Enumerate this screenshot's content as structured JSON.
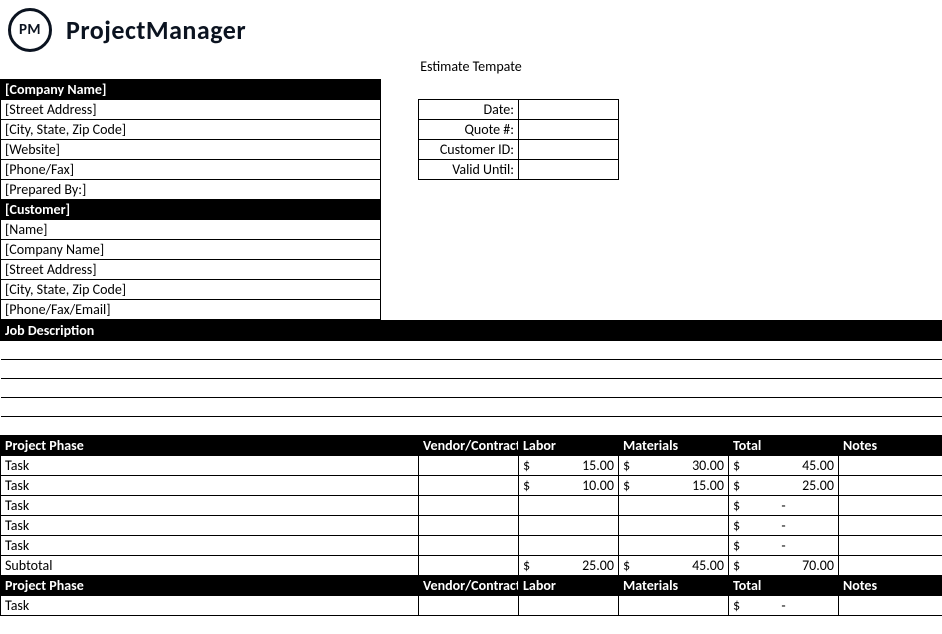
{
  "brand": {
    "badge": "PM",
    "name": "ProjectManager"
  },
  "doc_title": "Estimate Tempate",
  "company_block": {
    "header": "[Company Name]",
    "street": "[Street Address]",
    "city": "[City, State, Zip Code]",
    "website": "[Website]",
    "phone": "[Phone/Fax]",
    "prepared": "[Prepared By:]"
  },
  "meta_labels": {
    "date": "Date:",
    "quote": "Quote #:",
    "customerid": "Customer ID:",
    "valid": "Valid Until:"
  },
  "meta_values": {
    "date": "",
    "quote": "",
    "customerid": "",
    "valid": ""
  },
  "customer_block": {
    "header": "[Customer]",
    "name": "[Name]",
    "company": "[Company Name]",
    "street": "[Street Address]",
    "city": "[City, State, Zip Code]",
    "contact": "[Phone/Fax/Email]"
  },
  "job_desc_header": "Job Description",
  "table_headers": {
    "phase": "Project Phase",
    "vendor": "Vendor/Contractor",
    "labor": "Labor",
    "materials": "Materials",
    "total": "Total",
    "notes": "Notes"
  },
  "currency": "$",
  "dash": "-",
  "labels": {
    "task": "Task",
    "subtotal": "Subtotal"
  },
  "phase1": {
    "rows": [
      {
        "phase": "Task",
        "vendor": "",
        "labor": "15.00",
        "materials": "30.00",
        "total": "45.00",
        "notes": ""
      },
      {
        "phase": "Task",
        "vendor": "",
        "labor": "10.00",
        "materials": "15.00",
        "total": "25.00",
        "notes": ""
      },
      {
        "phase": "Task",
        "vendor": "",
        "labor": "",
        "materials": "",
        "total": "-",
        "notes": ""
      },
      {
        "phase": "Task",
        "vendor": "",
        "labor": "",
        "materials": "",
        "total": "-",
        "notes": ""
      },
      {
        "phase": "Task",
        "vendor": "",
        "labor": "",
        "materials": "",
        "total": "-",
        "notes": ""
      }
    ],
    "subtotal": {
      "labor": "25.00",
      "materials": "45.00",
      "total": "70.00"
    }
  },
  "phase2": {
    "rows": [
      {
        "phase": "Task",
        "vendor": "",
        "labor": "",
        "materials": "",
        "total": "-",
        "notes": ""
      }
    ]
  }
}
